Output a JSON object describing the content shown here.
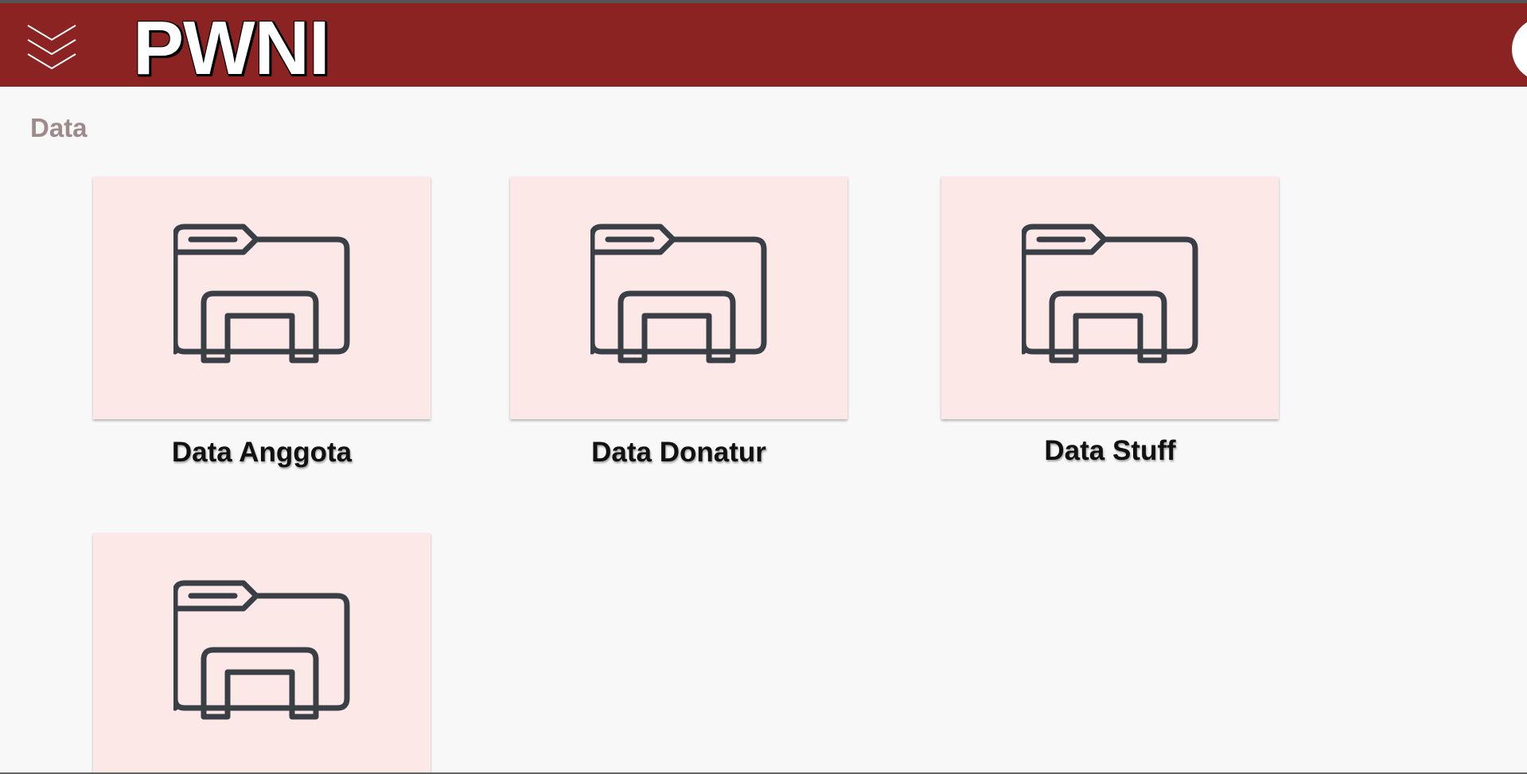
{
  "header": {
    "title": "PWNI",
    "menu_icon": "chevrons-down-icon",
    "profile_icon": "avatar-circle"
  },
  "section": {
    "title": "Data"
  },
  "cards": [
    {
      "label": "Data Anggota",
      "icon": "folder-icon"
    },
    {
      "label": "Data Donatur",
      "icon": "folder-icon"
    },
    {
      "label": "Data Stuff",
      "icon": "folder-icon"
    },
    {
      "label": "",
      "icon": "folder-icon"
    }
  ],
  "colors": {
    "header_bg": "#8b2323",
    "page_bg": "#f8f8f8",
    "card_bg": "#fde8e8",
    "section_title": "#9e8a8a",
    "icon_stroke": "#3a3f45"
  }
}
